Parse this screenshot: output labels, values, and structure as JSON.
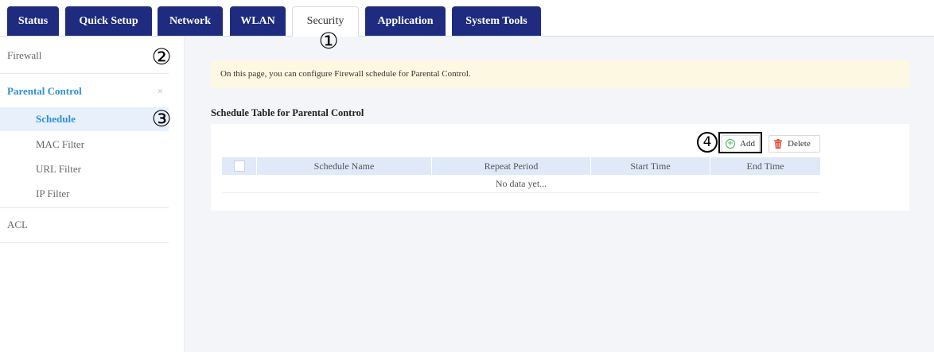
{
  "tabs": [
    {
      "label": "Status"
    },
    {
      "label": "Quick Setup"
    },
    {
      "label": "Network"
    },
    {
      "label": "WLAN"
    },
    {
      "label": "Security",
      "active": true
    },
    {
      "label": "Application"
    },
    {
      "label": "System Tools"
    }
  ],
  "sidebar": {
    "firewall": "Firewall",
    "parental_control": "Parental Control",
    "collapse_symbol": "×",
    "sub_items": [
      "Schedule",
      "MAC Filter",
      "URL Filter",
      "IP Filter"
    ],
    "acl": "ACL"
  },
  "main": {
    "notice": "On this page, you can configure Firewall schedule for Parental Control.",
    "section_title": "Schedule Table for Parental Control",
    "add_label": "Add",
    "delete_label": "Delete",
    "columns": [
      "Schedule Name",
      "Repeat Period",
      "Start Time",
      "End Time"
    ],
    "empty_text": "No data yet..."
  },
  "markers": [
    "①",
    "②",
    "③",
    "4"
  ],
  "colors": {
    "tab_bg": "#1f2b7e",
    "accent": "#2f8fd6",
    "notice_bg": "#fdf8e1",
    "table_header_bg": "#dfe9f7",
    "add_icon": "#4caf50",
    "delete_icon": "#e0453a"
  }
}
